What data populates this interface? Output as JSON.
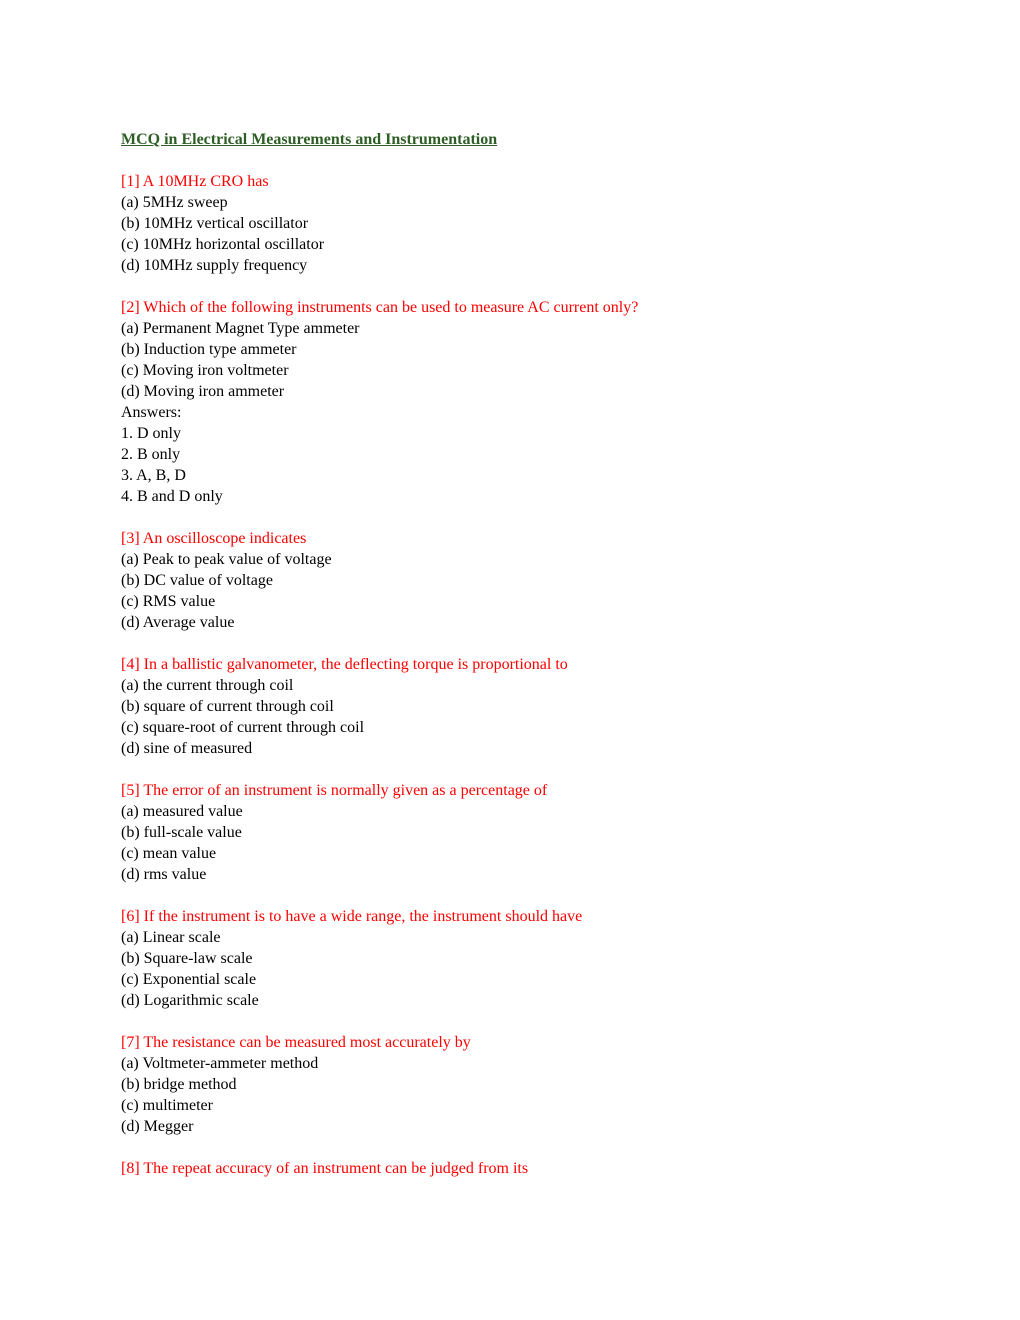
{
  "document": {
    "title": "MCQ in Electrical Measurements and Instrumentation",
    "colors": {
      "title": "#2e5e26",
      "question": "#ff0000",
      "body": "#000000"
    },
    "questions": [
      {
        "text": "[1] A 10MHz CRO has",
        "options": [
          "(a) 5MHz sweep",
          "(b) 10MHz vertical oscillator",
          "(c) 10MHz horizontal oscillator",
          "(d) 10MHz supply frequency"
        ]
      },
      {
        "text": "[2] Which of the following instruments can be used to measure AC current only?",
        "options": [
          "(a) Permanent Magnet Type ammeter",
          "(b) Induction type ammeter",
          "(c) Moving iron voltmeter",
          "(d) Moving iron ammeter"
        ],
        "answers_label": "Answers:",
        "answers": [
          "1. D only",
          "2. B only",
          "3. A, B, D",
          "4. B and D only"
        ]
      },
      {
        "text": "[3] An oscilloscope indicates",
        "options": [
          "(a) Peak to peak value of voltage",
          "(b) DC value of voltage",
          "(c) RMS value",
          "(d) Average value"
        ]
      },
      {
        "text": "[4] In a ballistic galvanometer, the deflecting torque is proportional to",
        "options": [
          "(a) the current through coil",
          "(b) square of current through coil",
          "(c) square-root of current through coil",
          "(d) sine of measured"
        ]
      },
      {
        "text": "[5] The error of an instrument is normally given as a percentage of",
        "options": [
          "(a) measured value",
          "(b) full-scale value",
          "(c) mean value",
          "(d) rms value"
        ]
      },
      {
        "text": "[6] If the instrument is to have a wide range, the instrument should have",
        "options": [
          "(a) Linear scale",
          "(b) Square-law scale",
          "(c) Exponential scale",
          "(d) Logarithmic scale"
        ]
      },
      {
        "text": "[7] The resistance can be measured most accurately by",
        "options": [
          "(a) Voltmeter-ammeter method",
          "(b) bridge method",
          "(c) multimeter",
          "(d) Megger"
        ]
      },
      {
        "text": "[8] The repeat accuracy of an instrument can be judged from its",
        "options": []
      }
    ]
  }
}
